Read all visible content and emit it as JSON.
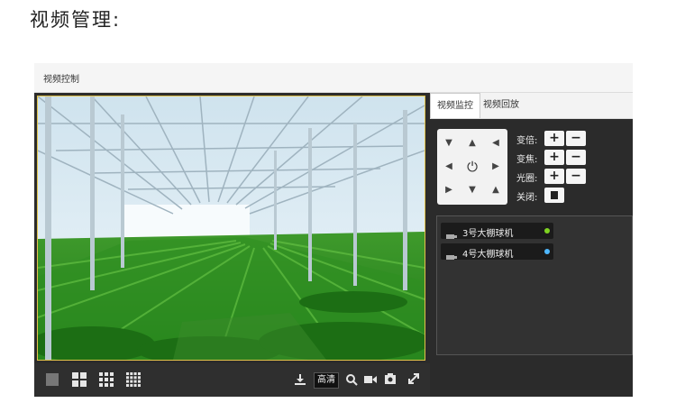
{
  "document": {
    "heading": "视频管理:"
  },
  "panel": {
    "title": "视频控制"
  },
  "tabs": [
    {
      "label": "视频监控",
      "active": true
    },
    {
      "label": "视频回放",
      "active": false
    }
  ],
  "toolbar": {
    "quality_label": "高清"
  },
  "ptz": {
    "zoom_label": "变倍:",
    "focus_label": "变焦:",
    "iris_label": "光圈:",
    "close_label": "关闭:",
    "plus": "+",
    "minus": "−"
  },
  "cameras": [
    {
      "label": "3号大棚球机",
      "status_color": "#7ed321"
    },
    {
      "label": "4号大棚球机",
      "status_color": "#4fb8ff"
    }
  ],
  "colors": {
    "accent_border": "#e2c34a",
    "panel_bg": "#2b2b2b",
    "online": "#7ed321",
    "info": "#4fb8ff"
  }
}
